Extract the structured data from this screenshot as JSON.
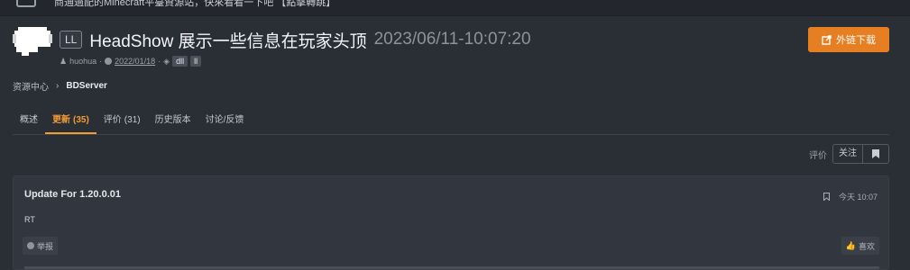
{
  "topbar": {
    "notice": "商通過配的Minecraft平臺資源站，快來看看一下吧 【點擊轉跳】"
  },
  "resource": {
    "prefix": "LL",
    "title": "HeadShow 展示一些信息在玩家头顶",
    "date": "2023/06/11-10:07:20"
  },
  "meta": {
    "author": "huohua",
    "date": "2022/01/18",
    "tags": [
      "dll",
      "ll"
    ]
  },
  "download_button": {
    "label": "外链下载"
  },
  "breadcrumb": {
    "items": [
      "资源中心",
      "BDServer"
    ]
  },
  "tabs": [
    {
      "label": "概述",
      "count": ""
    },
    {
      "label": "更新",
      "count": "(35)"
    },
    {
      "label": "评价",
      "count": "(31)"
    },
    {
      "label": "历史版本",
      "count": ""
    },
    {
      "label": "讨论/反馈",
      "count": ""
    }
  ],
  "rating_bar": {
    "label": "评价",
    "follow_label": "关注"
  },
  "update_card": {
    "title": "Update For 1.20.0.01",
    "time": "今天 10:07",
    "body": "RT",
    "report_label": "举报",
    "like_label": "喜欢"
  },
  "colors": {
    "accent": "#e67e22",
    "active_tab": "#f39c34",
    "background": "#2a2e35"
  }
}
